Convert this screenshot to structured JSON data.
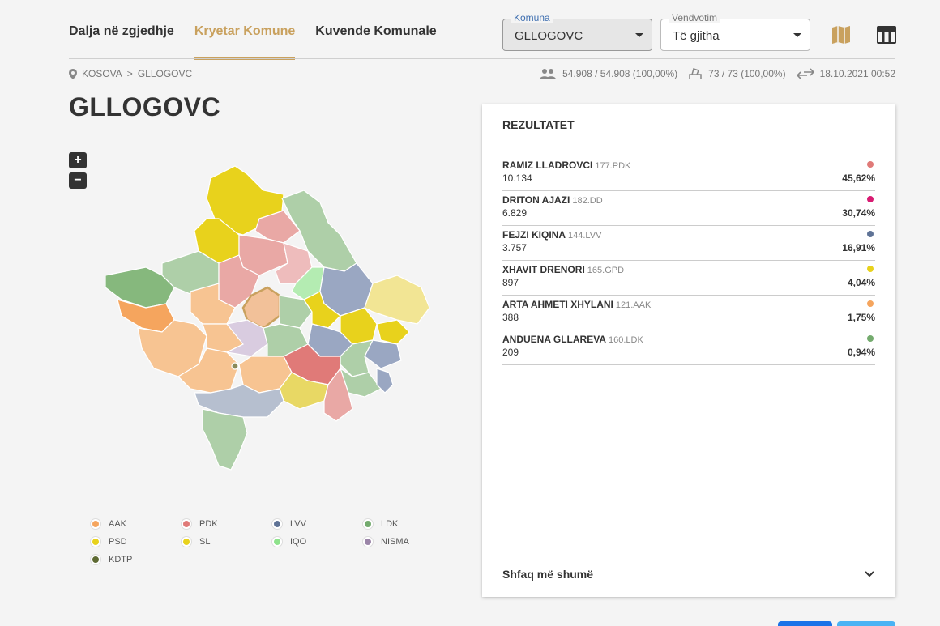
{
  "nav": {
    "tabs": [
      {
        "label": "Dalja në zgjedhje"
      },
      {
        "label": "Kryetar Komune"
      },
      {
        "label": "Kuvende Komunale"
      }
    ],
    "komuna": {
      "legend": "Komuna",
      "value": "GLLOGOVC"
    },
    "vendvotim": {
      "legend": "Vendvotim",
      "value": "Të gjitha"
    },
    "icons": [
      "map-icon",
      "table-icon"
    ]
  },
  "breadcrumb": {
    "root": "KOSOVA",
    "separator": ">",
    "current": "GLLOGOVC"
  },
  "stats": {
    "voters": "54.908 / 54.908 (100,00%)",
    "stations": "73 / 73 (100,00%)",
    "updated": "18.10.2021 00:52"
  },
  "title": "GLLOGOVC",
  "zoom": {
    "in": "+",
    "out": "−"
  },
  "legend": [
    {
      "label": "AAK",
      "color": "#f5a55e"
    },
    {
      "label": "PDK",
      "color": "#e07a78"
    },
    {
      "label": "LVV",
      "color": "#5f7396"
    },
    {
      "label": "LDK",
      "color": "#74ab6e"
    },
    {
      "label": "PSD",
      "color": "#e8d21c"
    },
    {
      "label": "SL",
      "color": "#e8d21c"
    },
    {
      "label": "IQO",
      "color": "#8ee28c"
    },
    {
      "label": "NISMA",
      "color": "#9b85a8"
    },
    {
      "label": "KDTP",
      "color": "#5e6a33"
    }
  ],
  "results": {
    "header": "REZULTATET",
    "rows": [
      {
        "name": "RAMIZ LLADROVCI",
        "code": "177.PDK",
        "votes": "10.134",
        "pct": "45,62%",
        "color": "#e07a78"
      },
      {
        "name": "DRITON AJAZI",
        "code": "182.DD",
        "votes": "6.829",
        "pct": "30,74%",
        "color": "#d81b72"
      },
      {
        "name": "FEJZI KIQINA",
        "code": "144.LVV",
        "votes": "3.757",
        "pct": "16,91%",
        "color": "#5f7396"
      },
      {
        "name": "XHAVIT DRENORI",
        "code": "165.GPD",
        "votes": "897",
        "pct": "4,04%",
        "color": "#e8d21c"
      },
      {
        "name": "ARTA AHMETI XHYLANI",
        "code": "121.AAK",
        "votes": "388",
        "pct": "1,75%",
        "color": "#f5a55e"
      },
      {
        "name": "ANDUENA GLLAREVA",
        "code": "160.LDK",
        "votes": "209",
        "pct": "0,94%",
        "color": "#74ab6e"
      }
    ],
    "more_label": "Shfaq më shumë"
  }
}
